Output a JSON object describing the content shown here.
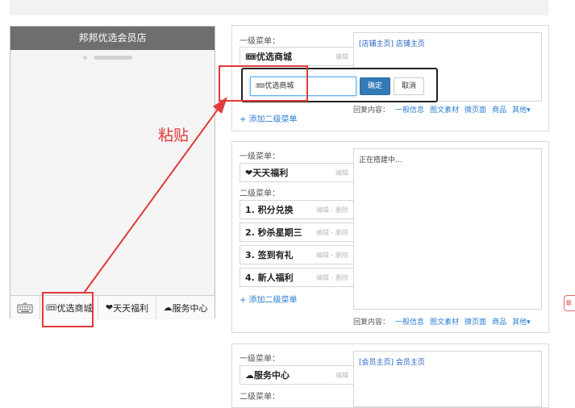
{
  "phone": {
    "title": "邦邦优选会员店",
    "menu": [
      {
        "icon": "keyboard-icon"
      },
      {
        "icon": "gift-icon",
        "icon_glyph": "🎟",
        "label": "优选商城"
      },
      {
        "icon": "heart-icon",
        "icon_glyph": "❤",
        "label": "天天福利"
      },
      {
        "icon": "service-icon",
        "icon_glyph": "☁",
        "label": "服务中心"
      }
    ]
  },
  "annotation": {
    "paste_label": "粘贴",
    "side_tag": "联"
  },
  "panels": [
    {
      "first_level_label": "一级菜单：",
      "menu_name": "优选商城",
      "menu_icon": "🎟",
      "edit_label": "编辑",
      "add_second_level": "+ 添加二级菜单",
      "content": "[店铺主页] 店铺主页",
      "reply_label": "回复内容：",
      "reply_links": [
        "一般信息",
        "图文素材",
        "微页面",
        "商品",
        "其他▾"
      ],
      "popup": {
        "input_value": "🎟优选商城",
        "confirm": "确定",
        "cancel": "取消"
      }
    },
    {
      "first_level_label": "一级菜单：",
      "menu_name": "天天福利",
      "menu_icon": "❤",
      "edit_label": "编辑",
      "second_level_label": "二级菜单：",
      "sub_items": [
        {
          "label": "1. 积分兑换",
          "actions": "编辑 - 删除"
        },
        {
          "label": "2. 秒杀星期三",
          "actions": "编辑 - 删除"
        },
        {
          "label": "3. 签到有礼",
          "actions": "编辑 - 删除"
        },
        {
          "label": "4. 新人福利",
          "actions": "编辑 - 删除"
        }
      ],
      "add_second_level": "+ 添加二级菜单",
      "content": "正在搭建中...",
      "reply_label": "回复内容：",
      "reply_links": [
        "一般信息",
        "图文素材",
        "微页面",
        "商品",
        "其他▾"
      ]
    },
    {
      "first_level_label": "一级菜单：",
      "menu_name": "服务中心",
      "menu_icon": "☁",
      "edit_label": "编辑",
      "second_level_label": "二级菜单：",
      "content": "[会员主页] 会员主页"
    }
  ],
  "colors": {
    "accent": "#337ab7",
    "link": "#2a7ed3",
    "annotation": "#e03a3a",
    "header": "#6e6e6e"
  }
}
